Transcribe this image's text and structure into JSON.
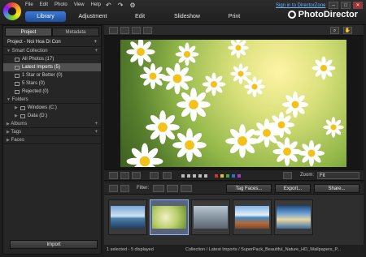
{
  "menu": [
    "File",
    "Edit",
    "Photo",
    "View",
    "Help"
  ],
  "sign_in": "Sign in to DirectorZone",
  "tabs": [
    "Library",
    "Adjustment",
    "Edit",
    "Slideshow",
    "Print"
  ],
  "brand": "PhotoDirector",
  "panel_tabs": [
    "Project",
    "Metadata"
  ],
  "project_name": "Project - Noi Hoa Di Con",
  "sections": {
    "smart_collection": "Smart Collection",
    "folders": "Folders",
    "albums": "Albums",
    "tags": "Tags",
    "faces": "Faces"
  },
  "smart_items": [
    "All Photos (17)",
    "Latest Imports (5)",
    "1 Star or Better (0)",
    "5 Stars (0)",
    "Rejected (0)"
  ],
  "folder_items": [
    "Windows (C:)",
    "Data (D:)"
  ],
  "import_label": "Import",
  "zoom_label": "Zoom:",
  "zoom_value": "Fit",
  "filter_label": "Filter:",
  "tag_faces_label": "Tag Faces...",
  "export_label": "Export...",
  "share_label": "Share...",
  "status_left": "1 selected - 5 displayed",
  "status_path": "Collection / Latest Imports / SuperPack_Beautiful_Nature_HD_Wallpapers_P...",
  "colors": {
    "accent": "#2f6fcf",
    "selected_item": "#505050"
  }
}
